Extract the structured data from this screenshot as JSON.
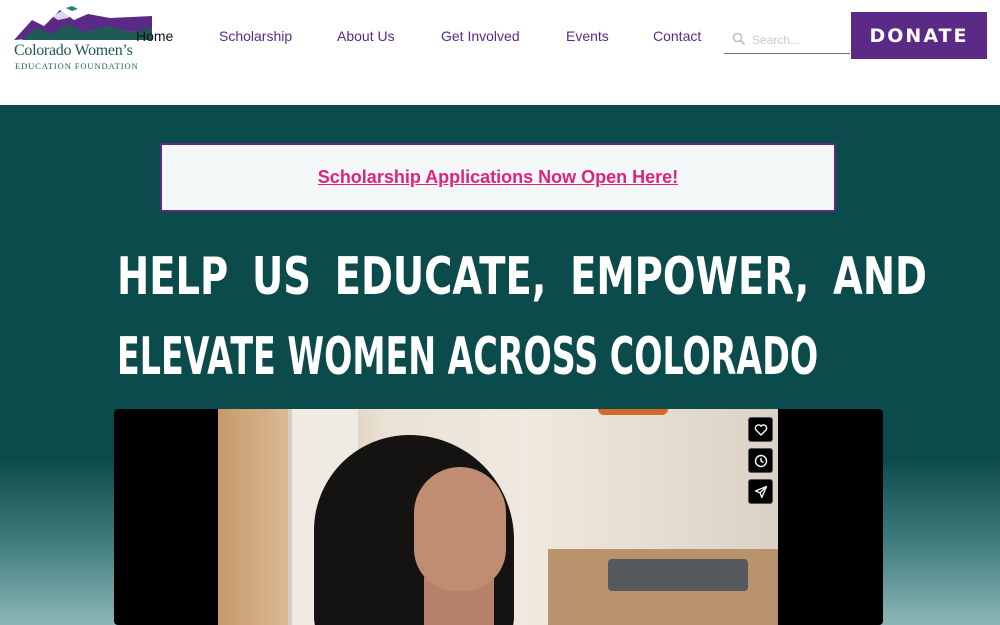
{
  "header": {
    "logo": {
      "line1": "Colorado Women’s",
      "line2": "EDUCATION FOUNDATION",
      "colors": {
        "purple": "#5b2a86",
        "teal": "#1f5a57"
      }
    },
    "nav": [
      {
        "label": "Home",
        "active": true
      },
      {
        "label": "Scholarship"
      },
      {
        "label": "About Us"
      },
      {
        "label": "Get Involved"
      },
      {
        "label": "Events"
      },
      {
        "label": "Contact"
      }
    ],
    "search": {
      "placeholder": "Search...",
      "icon": "search-icon"
    },
    "donate_label": "DONATE"
  },
  "hero": {
    "banner_link": "Scholarship Applications Now Open Here!",
    "headline_line1": "HELP US EDUCATE, EMPOWER, AND",
    "headline_line2": "ELEVATE WOMEN ACROSS COLORADO",
    "video": {
      "buttons": [
        "heart-icon",
        "clock-icon",
        "share-icon"
      ]
    }
  },
  "colors": {
    "brand_purple": "#5b2a86",
    "hero_teal": "#0c4b4c",
    "banner_link_pink": "#e0227a"
  }
}
